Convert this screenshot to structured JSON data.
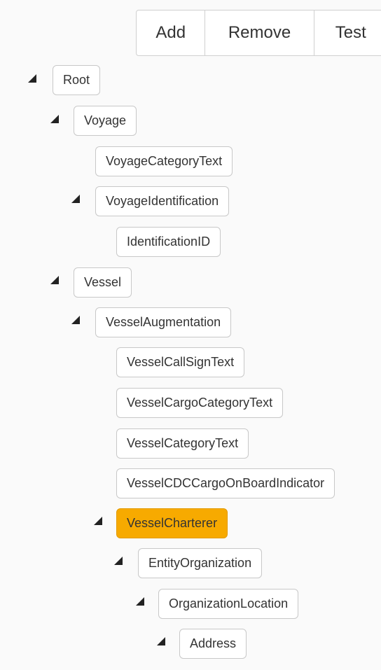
{
  "toolbar": {
    "add_label": "Add",
    "remove_label": "Remove",
    "test_label": "Test"
  },
  "tree": {
    "root": "Root",
    "voyage": "Voyage",
    "voyage_category_text": "VoyageCategoryText",
    "voyage_identification": "VoyageIdentification",
    "identification_id": "IdentificationID",
    "vessel": "Vessel",
    "vessel_augmentation": "VesselAugmentation",
    "vessel_call_sign_text": "VesselCallSignText",
    "vessel_cargo_category_text": "VesselCargoCategoryText",
    "vessel_category_text": "VesselCategoryText",
    "vessel_cdc_cargo_on_board_indicator": "VesselCDCCargoOnBoardIndicator",
    "vessel_charterer": "VesselCharterer",
    "entity_organization": "EntityOrganization",
    "organization_location": "OrganizationLocation",
    "address": "Address"
  },
  "colors": {
    "selected_node": "#f7aa00",
    "toggle": "#222222"
  },
  "icons": {
    "toggle": "expanded-triangle-icon"
  }
}
